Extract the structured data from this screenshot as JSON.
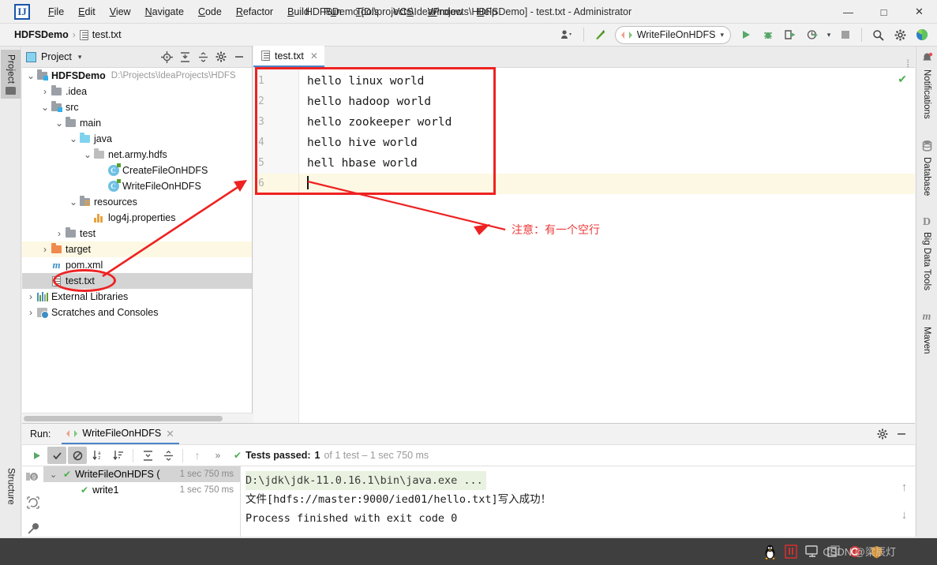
{
  "window": {
    "title": "HDFSDemo [D:\\projects\\IdeaProjects\\HDFSDemo] - test.txt - Administrator",
    "minimize": "—",
    "maximize": "□",
    "close": "✕",
    "logo_text": "IJ"
  },
  "menu": [
    {
      "label": "File",
      "mnemonic": "F"
    },
    {
      "label": "Edit",
      "mnemonic": "E"
    },
    {
      "label": "View",
      "mnemonic": "V"
    },
    {
      "label": "Navigate",
      "mnemonic": "N"
    },
    {
      "label": "Code",
      "mnemonic": "C"
    },
    {
      "label": "Refactor",
      "mnemonic": "R"
    },
    {
      "label": "Build",
      "mnemonic": "B"
    },
    {
      "label": "Run",
      "mnemonic": "u"
    },
    {
      "label": "Tools",
      "mnemonic": "T"
    },
    {
      "label": "VCS",
      "mnemonic": "S"
    },
    {
      "label": "Window",
      "mnemonic": "W"
    },
    {
      "label": "Help",
      "mnemonic": "H"
    }
  ],
  "breadcrumb": {
    "root": "HDFSDemo",
    "separator": "›",
    "leaf": "test.txt"
  },
  "toolbar": {
    "run_config": "WriteFileOnHDFS",
    "dropdown_arrow": "▾",
    "run_icon": "▶",
    "debug_icon": "🐞",
    "coverage_icon": "⭮",
    "profile_icon": "⦿",
    "stop_icon": "■",
    "search_icon": "⌕",
    "settings_icon": "⚙",
    "updates_icon": "◖"
  },
  "left_strip": {
    "project_tab": "Project",
    "structure_tab": "Structure"
  },
  "right_strip": [
    {
      "label": "Notifications",
      "icon": "bell-icon"
    },
    {
      "label": "Database",
      "icon": "database-icon"
    },
    {
      "label": "Big Data Tools",
      "icon": "D"
    },
    {
      "label": "Maven",
      "icon": "m"
    }
  ],
  "project_panel": {
    "title": "Project",
    "actions": [
      "locate-icon",
      "expand-all-icon",
      "collapse-all-icon",
      "settings-icon",
      "hide-icon"
    ],
    "tree": [
      {
        "indent": 0,
        "twist": "⌄",
        "icon": "module-folder",
        "label": "HDFSDemo",
        "bold": true,
        "path": "D:\\Projects\\IdeaProjects\\HDFS",
        "state": "normal"
      },
      {
        "indent": 1,
        "twist": "›",
        "icon": "folder",
        "label": ".idea",
        "bold": false,
        "path": "",
        "state": "normal"
      },
      {
        "indent": 1,
        "twist": "⌄",
        "icon": "folder-src",
        "label": "src",
        "bold": false,
        "path": "",
        "state": "normal"
      },
      {
        "indent": 2,
        "twist": "⌄",
        "icon": "folder",
        "label": "main",
        "bold": false,
        "path": "",
        "state": "normal"
      },
      {
        "indent": 3,
        "twist": "⌄",
        "icon": "folder-blue",
        "label": "java",
        "bold": false,
        "path": "",
        "state": "normal"
      },
      {
        "indent": 4,
        "twist": "⌄",
        "icon": "package",
        "label": "net.army.hdfs",
        "bold": false,
        "path": "",
        "state": "normal"
      },
      {
        "indent": 5,
        "twist": "",
        "icon": "class",
        "label": "CreateFileOnHDFS",
        "bold": false,
        "path": "",
        "state": "normal"
      },
      {
        "indent": 5,
        "twist": "",
        "icon": "class",
        "label": "WriteFileOnHDFS",
        "bold": false,
        "path": "",
        "state": "normal"
      },
      {
        "indent": 3,
        "twist": "⌄",
        "icon": "folder-res",
        "label": "resources",
        "bold": false,
        "path": "",
        "state": "normal"
      },
      {
        "indent": 4,
        "twist": "",
        "icon": "properties",
        "label": "log4j.properties",
        "bold": false,
        "path": "",
        "state": "normal"
      },
      {
        "indent": 2,
        "twist": "›",
        "icon": "folder",
        "label": "test",
        "bold": false,
        "path": "",
        "state": "normal"
      },
      {
        "indent": 1,
        "twist": "›",
        "icon": "folder-orange",
        "label": "target",
        "bold": false,
        "path": "",
        "state": "highlight"
      },
      {
        "indent": 1,
        "twist": "",
        "icon": "maven",
        "label": "pom.xml",
        "bold": false,
        "path": "",
        "state": "normal"
      },
      {
        "indent": 1,
        "twist": "",
        "icon": "text-file",
        "label": "test.txt",
        "bold": false,
        "path": "",
        "state": "selected"
      },
      {
        "indent": 0,
        "twist": "›",
        "icon": "libraries",
        "label": "External Libraries",
        "bold": false,
        "path": "",
        "state": "normal"
      },
      {
        "indent": 0,
        "twist": "›",
        "icon": "scratches",
        "label": "Scratches and Consoles",
        "bold": false,
        "path": "",
        "state": "normal"
      }
    ]
  },
  "editor": {
    "tab_label": "test.txt",
    "tab_close": "✕",
    "inspection_ok": "✔",
    "lines": [
      {
        "n": "1",
        "text": "hello linux world",
        "current": false
      },
      {
        "n": "2",
        "text": "hello hadoop world",
        "current": false
      },
      {
        "n": "3",
        "text": "hello zookeeper world",
        "current": false
      },
      {
        "n": "4",
        "text": "hello hive world",
        "current": false
      },
      {
        "n": "5",
        "text": "hell hbase world",
        "current": false
      },
      {
        "n": "6",
        "text": "",
        "current": true
      }
    ]
  },
  "annotation": {
    "note": "注意：有一个空行",
    "color": "#ef3b3b"
  },
  "run_panel": {
    "label": "Run:",
    "tab": "WriteFileOnHDFS",
    "tab_close": "✕",
    "toolbar_icons": [
      "rerun-icon",
      "show-passed-icon",
      "show-ignored-icon",
      "sort-alpha-icon",
      "sort-duration-icon",
      "expand-all-icon",
      "collapse-all-icon",
      "prev-icon",
      "next-icon"
    ],
    "status_prefix": "Tests passed:",
    "status_count": "1",
    "status_suffix": "of 1 test – 1 sec 750 ms",
    "settings_icon": "⚙",
    "hide_icon": "—",
    "tests": [
      {
        "indent": 0,
        "twist": "⌄",
        "label": "WriteFileOnHDFS (",
        "time": "1 sec 750 ms",
        "selected": true
      },
      {
        "indent": 1,
        "twist": "",
        "label": "write1",
        "time": "1 sec 750 ms",
        "selected": false
      }
    ],
    "console": [
      {
        "text": "D:\\jdk\\jdk-11.0.16.1\\bin\\java.exe ...",
        "style": "cmd"
      },
      {
        "text": "文件[hdfs://master:9000/ied01/hello.txt]写入成功！",
        "style": "normal"
      },
      {
        "text": "Process finished with exit code 0",
        "style": "normal"
      }
    ],
    "side_icons": [
      "breakpoint-9-icon",
      "rerun-failed-icon",
      "wrench-icon"
    ],
    "scroll_icons": [
      "arrow-up-icon",
      "arrow-down-icon",
      "wrap-text-icon"
    ]
  },
  "taskbar": {
    "icons": [
      "penguin-icon",
      "app-red-icon",
      "monitor-icon",
      "windows-icon",
      "csdn-icon",
      "shield-icon"
    ],
    "watermark": "CSDN @梁辰灯"
  }
}
